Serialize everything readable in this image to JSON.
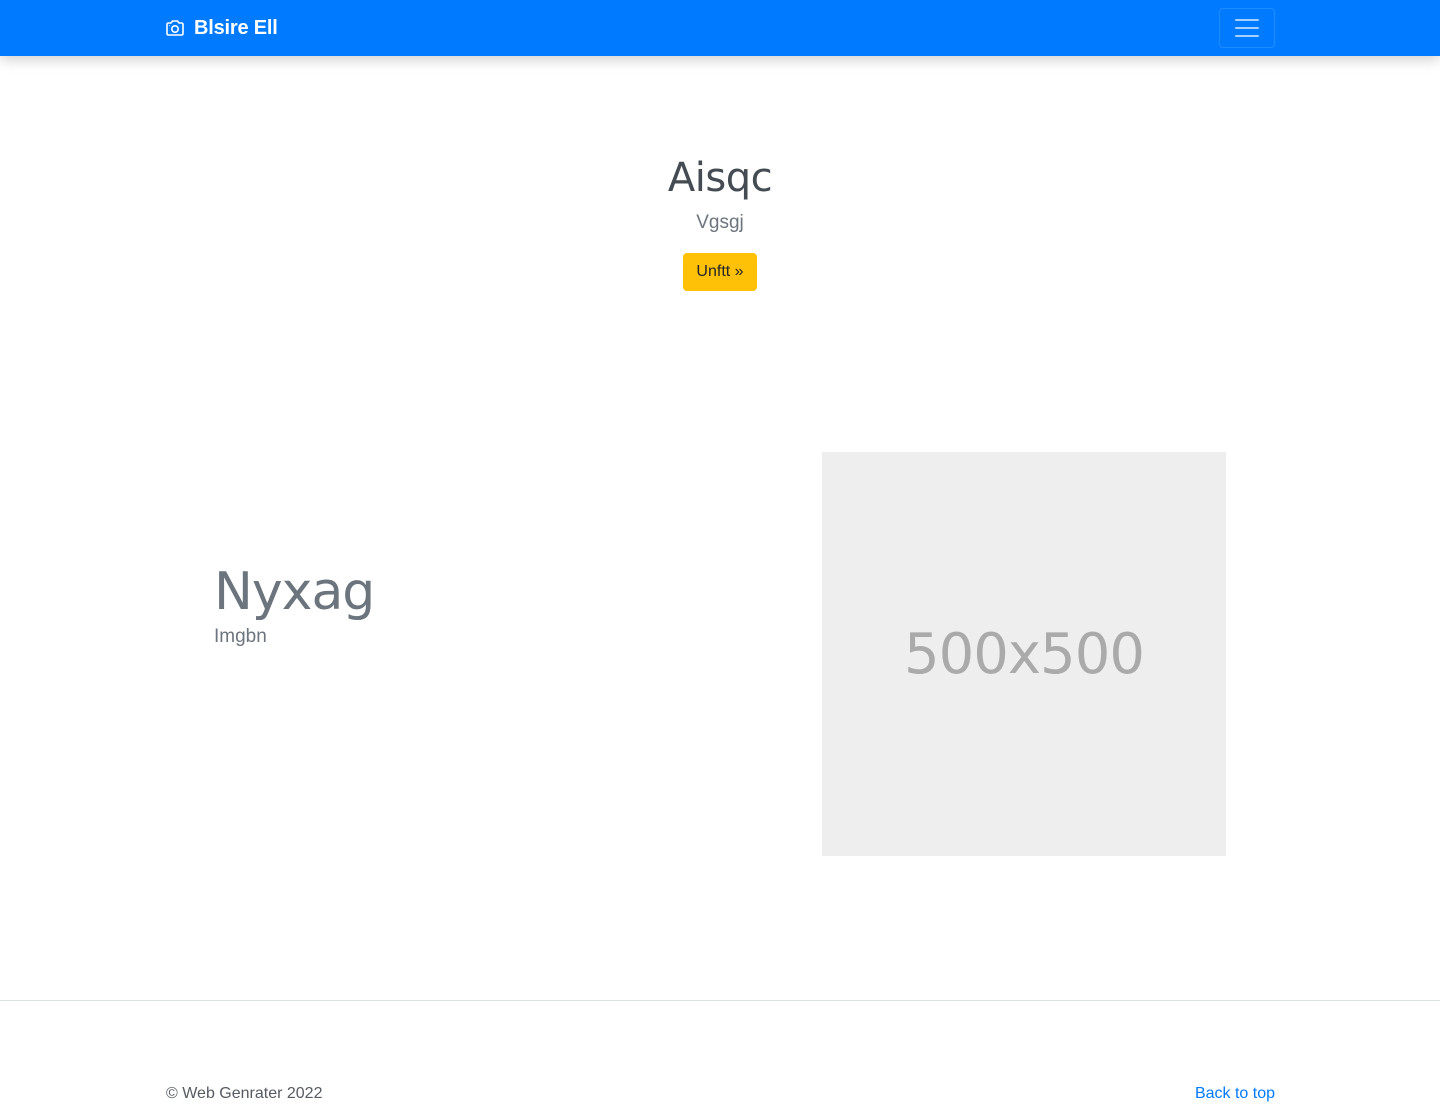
{
  "navbar": {
    "brand_icon": "camera-icon",
    "brand_text": "Blsire Ell",
    "toggler_icon": "hamburger-menu-icon",
    "bg_color": "#007bff"
  },
  "hero": {
    "title": "Aisqc",
    "lead": "Vgsgj",
    "button_label": "Unftt »",
    "button_color": "#ffc107"
  },
  "feature": {
    "heading": "Nyxag",
    "subtext": "Imgbn",
    "image_label": "500x500"
  },
  "footer": {
    "copyright": "© Web Genrater 2022",
    "back_to_top": "Back to top",
    "link_color": "#007bff"
  }
}
